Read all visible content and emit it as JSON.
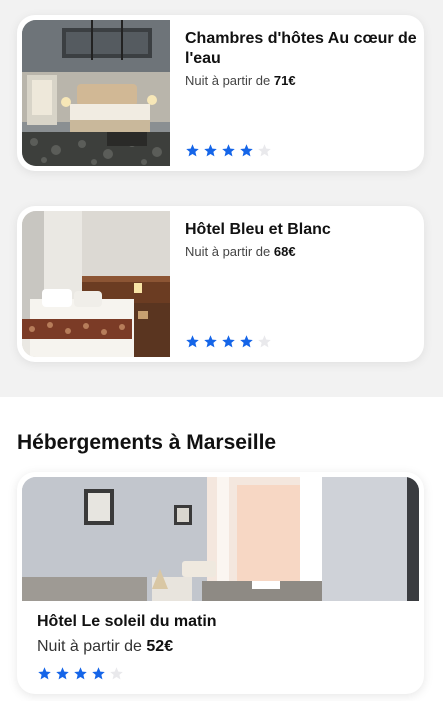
{
  "cards": [
    {
      "title": "Chambres d'hôtes Au cœur de l'eau",
      "price_prefix": "Nuit à partir de ",
      "price": "71€",
      "rating": 4,
      "max_rating": 5
    },
    {
      "title": "Hôtel Bleu et Blanc",
      "price_prefix": "Nuit à partir de ",
      "price": "68€",
      "rating": 4,
      "max_rating": 5
    }
  ],
  "marseille": {
    "section_title": "Hébergements à Marseille",
    "card": {
      "title": "Hôtel Le soleil du matin",
      "price_prefix": "Nuit à partir de ",
      "price": "52€",
      "rating": 4,
      "max_rating": 5
    }
  },
  "colors": {
    "star_on": "#1565e8",
    "star_off": "#e9e9ec"
  }
}
